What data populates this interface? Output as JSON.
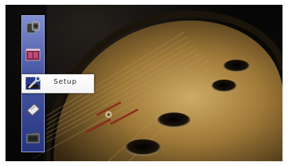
{
  "menu": {
    "items": [
      {
        "id": "item-1",
        "icon": "speaker-icon"
      },
      {
        "id": "item-2",
        "icon": "scene-icon"
      },
      {
        "id": "setup",
        "icon": "wrench-icon",
        "label": "Setup",
        "selected": true
      },
      {
        "id": "item-4",
        "icon": "card-icon"
      },
      {
        "id": "item-5",
        "icon": "folder-icon"
      }
    ]
  },
  "colors": {
    "panel_top": "#7f8fcf",
    "panel_bottom": "#26357e",
    "selected_background": "#ffffff",
    "selected_text": "#1d1d2a"
  }
}
